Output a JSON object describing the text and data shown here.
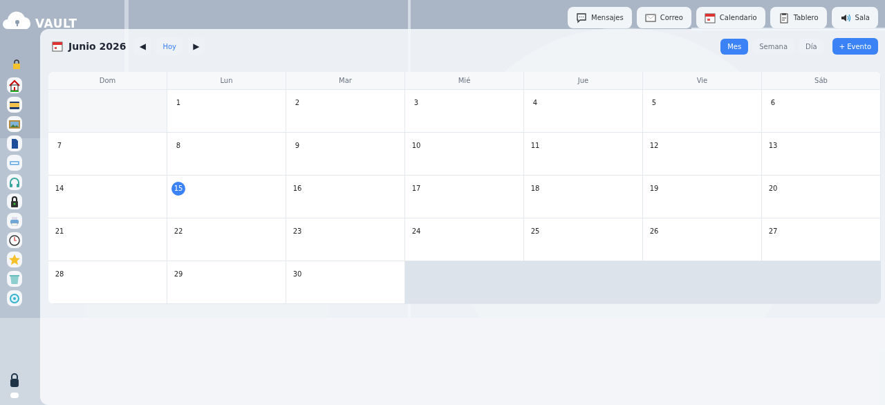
{
  "logo": {
    "text": "VAULT"
  },
  "top_nav": [
    {
      "label": "Mensajes"
    },
    {
      "label": "Correo"
    },
    {
      "label": "Calendario"
    },
    {
      "label": "Tablero"
    },
    {
      "label": "Sala"
    }
  ],
  "calendar": {
    "title": "Junio 2026",
    "today_button": "Hoy",
    "prev": "◀",
    "next": "▶",
    "views": [
      {
        "label": "Mes",
        "selected": true
      },
      {
        "label": "Semana",
        "selected": false
      },
      {
        "label": "Día",
        "selected": false
      }
    ],
    "add_button": "+ Evento",
    "weekdays": [
      "Dom",
      "Lun",
      "Mar",
      "Mié",
      "Jue",
      "Vie",
      "Sáb"
    ],
    "cells": [
      {
        "kind": "lead"
      },
      {
        "kind": "day",
        "day": "1",
        "today": false
      },
      {
        "kind": "day",
        "day": "2",
        "today": false
      },
      {
        "kind": "day",
        "day": "3",
        "today": false
      },
      {
        "kind": "day",
        "day": "4",
        "today": false
      },
      {
        "kind": "day",
        "day": "5",
        "today": false
      },
      {
        "kind": "day",
        "day": "6",
        "today": false
      },
      {
        "kind": "day",
        "day": "7",
        "today": false
      },
      {
        "kind": "day",
        "day": "8",
        "today": false
      },
      {
        "kind": "day",
        "day": "9",
        "today": false
      },
      {
        "kind": "day",
        "day": "10",
        "today": false
      },
      {
        "kind": "day",
        "day": "11",
        "today": false
      },
      {
        "kind": "day",
        "day": "12",
        "today": false
      },
      {
        "kind": "day",
        "day": "13",
        "today": false
      },
      {
        "kind": "day",
        "day": "14",
        "today": false
      },
      {
        "kind": "day",
        "day": "15",
        "today": true
      },
      {
        "kind": "day",
        "day": "16",
        "today": false
      },
      {
        "kind": "day",
        "day": "17",
        "today": false
      },
      {
        "kind": "day",
        "day": "18",
        "today": false
      },
      {
        "kind": "day",
        "day": "19",
        "today": false
      },
      {
        "kind": "day",
        "day": "20",
        "today": false
      },
      {
        "kind": "day",
        "day": "21",
        "today": false
      },
      {
        "kind": "day",
        "day": "22",
        "today": false
      },
      {
        "kind": "day",
        "day": "23",
        "today": false
      },
      {
        "kind": "day",
        "day": "24",
        "today": false
      },
      {
        "kind": "day",
        "day": "25",
        "today": false
      },
      {
        "kind": "day",
        "day": "26",
        "today": false
      },
      {
        "kind": "day",
        "day": "27",
        "today": false
      },
      {
        "kind": "day",
        "day": "28",
        "today": false
      },
      {
        "kind": "day",
        "day": "29",
        "today": false
      },
      {
        "kind": "day",
        "day": "30",
        "today": false
      },
      {
        "kind": "trail"
      },
      {
        "kind": "trail"
      },
      {
        "kind": "trail"
      },
      {
        "kind": "trail"
      }
    ]
  }
}
